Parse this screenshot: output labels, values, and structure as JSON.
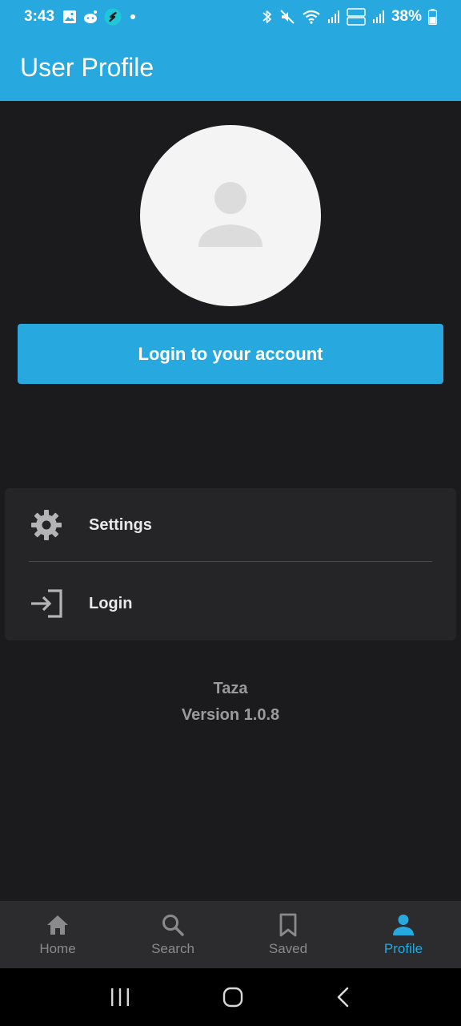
{
  "status_bar": {
    "time": "3:43",
    "battery": "38%",
    "icons": [
      "gallery-icon",
      "reddit-icon",
      "app-s-icon",
      "dot-icon",
      "bluetooth-icon",
      "mute-icon",
      "wifi-icon",
      "signal-icon",
      "volte-icon",
      "signal-icon",
      "battery-icon"
    ]
  },
  "header": {
    "title": "User Profile"
  },
  "profile": {
    "avatar_icon": "person-icon",
    "login_button_label": "Login to your account"
  },
  "menu": {
    "items": [
      {
        "label": "Settings",
        "icon": "gear-icon"
      },
      {
        "label": "Login",
        "icon": "login-icon"
      }
    ]
  },
  "app_info": {
    "name": "Taza",
    "version": "Version 1.0.8"
  },
  "bottom_nav": {
    "items": [
      {
        "label": "Home",
        "icon": "home-icon",
        "active": false
      },
      {
        "label": "Search",
        "icon": "search-icon",
        "active": false
      },
      {
        "label": "Saved",
        "icon": "bookmark-icon",
        "active": false
      },
      {
        "label": "Profile",
        "icon": "person-icon",
        "active": true
      }
    ]
  },
  "colors": {
    "accent": "#27a9e0",
    "background": "#1b1b1d",
    "card": "#252527",
    "nav_background": "#2c2c2e",
    "inactive": "#8a8a8d"
  }
}
